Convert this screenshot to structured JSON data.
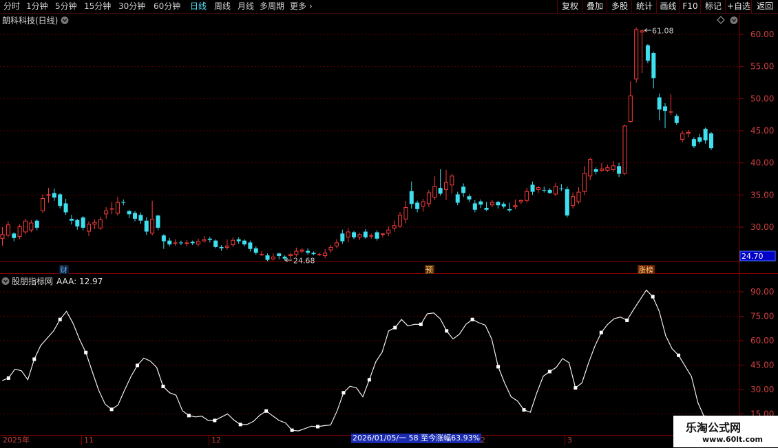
{
  "toolbar": {
    "timeframes": [
      "分时",
      "1分钟",
      "5分钟",
      "15分钟",
      "30分钟",
      "60分钟",
      "日线",
      "周线",
      "月线",
      "多周期",
      "更多"
    ],
    "active": "日线",
    "right_buttons": [
      "复权",
      "叠加",
      "多股",
      "统计",
      "画线",
      "F10",
      "标记",
      "+自选",
      "返回"
    ]
  },
  "main": {
    "title": "朗科科技(日线)",
    "price_axis": [
      "60.00",
      "55.00",
      "50.00",
      "45.00",
      "40.00",
      "35.00",
      "30.00"
    ],
    "last_price": "24.70",
    "high_label": "61.08",
    "low_label": "24.68",
    "markers": [
      "财",
      "预",
      "涨榜"
    ]
  },
  "indicator": {
    "name": "股朋指标网",
    "line_label": "AAA: 12.97",
    "axis": [
      "90.00",
      "75.00",
      "60.00",
      "45.00",
      "30.00",
      "15.00"
    ]
  },
  "xaxis": {
    "labels": [
      "2025年",
      "11",
      "12",
      "2",
      "3"
    ]
  },
  "status_text": "2026/01/05/一 58 至今涨幅63.93%",
  "watermark": {
    "text": "乐淘公式网",
    "url": "www.60lt.com"
  },
  "colors": {
    "up": "#ff3c3c",
    "down": "#3ee0f0",
    "grid": "#6a0000",
    "active_tab": "#4fe6ff"
  },
  "chart_data": {
    "type": "candlestick",
    "candles": [
      [
        28.2,
        28.9,
        27.1,
        30.0
      ],
      [
        28.7,
        30.4,
        28.4,
        30.9
      ],
      [
        29.0,
        28.3,
        27.8,
        29.2
      ],
      [
        28.5,
        30.1,
        28.1,
        30.4
      ],
      [
        29.2,
        31.0,
        28.9,
        31.3
      ],
      [
        29.5,
        30.7,
        29.2,
        31.1
      ],
      [
        31.0,
        29.9,
        29.5,
        31.2
      ],
      [
        32.5,
        34.5,
        32.2,
        35.1
      ],
      [
        34.9,
        35.1,
        33.8,
        36.1
      ],
      [
        35.3,
        34.6,
        34.1,
        36.0
      ],
      [
        35.1,
        33.3,
        32.9,
        35.3
      ],
      [
        33.7,
        32.3,
        31.9,
        34.4
      ],
      [
        31.3,
        31.0,
        30.4,
        31.9
      ],
      [
        31.1,
        30.1,
        29.6,
        31.3
      ],
      [
        31.5,
        29.9,
        29.5,
        31.7
      ],
      [
        29.3,
        30.5,
        28.6,
        30.9
      ],
      [
        30.4,
        30.8,
        29.7,
        31.2
      ],
      [
        29.8,
        31.2,
        29.6,
        31.6
      ],
      [
        32.0,
        32.6,
        31.3,
        33.1
      ],
      [
        32.8,
        32.9,
        32.0,
        33.9
      ],
      [
        32.1,
        33.9,
        31.8,
        34.7
      ],
      [
        33.9,
        33.8,
        33.4,
        34.3
      ],
      [
        32.5,
        32.0,
        31.4,
        32.7
      ],
      [
        32.2,
        31.3,
        30.9,
        32.5
      ],
      [
        31.9,
        31.0,
        30.5,
        32.3
      ],
      [
        31.0,
        29.3,
        28.8,
        31.5
      ],
      [
        29.0,
        31.3,
        28.7,
        34.1
      ],
      [
        31.8,
        29.9,
        29.5,
        31.9
      ],
      [
        28.7,
        27.8,
        26.6,
        28.9
      ],
      [
        27.9,
        27.3,
        27.0,
        28.3
      ],
      [
        27.6,
        27.6,
        27.1,
        28.1
      ],
      [
        27.6,
        27.5,
        27.2,
        27.9
      ],
      [
        27.4,
        27.6,
        27.0,
        28.0
      ],
      [
        27.7,
        27.5,
        27.2,
        27.9
      ],
      [
        27.3,
        27.8,
        27.0,
        28.2
      ],
      [
        27.8,
        28.1,
        27.6,
        28.6
      ],
      [
        28.2,
        28.0,
        27.6,
        28.5
      ],
      [
        27.9,
        26.9,
        26.7,
        28.1
      ],
      [
        26.9,
        26.7,
        26.3,
        27.2
      ],
      [
        26.8,
        27.1,
        26.5,
        28.1
      ],
      [
        27.2,
        28.0,
        26.9,
        28.4
      ],
      [
        28.1,
        27.8,
        27.4,
        28.4
      ],
      [
        27.9,
        27.3,
        27.0,
        28.1
      ],
      [
        27.6,
        26.6,
        26.2,
        27.9
      ],
      [
        26.7,
        26.0,
        25.7,
        27.0
      ],
      [
        25.7,
        25.8,
        25.5,
        26.3
      ],
      [
        25.6,
        24.9,
        24.7,
        25.9
      ],
      [
        25.0,
        25.4,
        24.8,
        25.9
      ],
      [
        25.9,
        25.5,
        25.0,
        26.0
      ],
      [
        25.4,
        25.1,
        24.8,
        25.6
      ],
      [
        25.5,
        25.8,
        25.1,
        26.0
      ],
      [
        25.7,
        26.3,
        25.4,
        26.8
      ],
      [
        26.2,
        26.5,
        25.9,
        26.7
      ],
      [
        26.3,
        26.0,
        25.7,
        26.7
      ],
      [
        26.0,
        25.8,
        25.6,
        26.2
      ],
      [
        25.8,
        25.8,
        25.5,
        26.0
      ],
      [
        25.5,
        26.0,
        25.2,
        26.6
      ],
      [
        26.4,
        26.9,
        26.0,
        27.2
      ],
      [
        27.0,
        27.6,
        26.7,
        28.1
      ],
      [
        29.0,
        27.8,
        27.4,
        29.6
      ],
      [
        28.4,
        29.3,
        27.6,
        29.8
      ],
      [
        29.2,
        28.4,
        28.1,
        29.4
      ],
      [
        28.4,
        28.9,
        28.0,
        29.1
      ],
      [
        29.3,
        28.4,
        28.2,
        29.7
      ],
      [
        28.6,
        28.7,
        28.2,
        29.0
      ],
      [
        29.2,
        28.2,
        27.9,
        29.5
      ],
      [
        28.8,
        29.0,
        28.4,
        29.1
      ],
      [
        29.0,
        29.6,
        28.6,
        30.1
      ],
      [
        29.8,
        30.3,
        29.3,
        31.0
      ],
      [
        30.1,
        31.9,
        29.9,
        32.3
      ],
      [
        31.2,
        33.1,
        30.6,
        34.1
      ],
      [
        35.6,
        33.6,
        32.9,
        37.1
      ],
      [
        33.8,
        32.8,
        32.3,
        34.1
      ],
      [
        33.2,
        34.0,
        32.4,
        34.4
      ],
      [
        33.6,
        35.4,
        33.1,
        35.8
      ],
      [
        34.6,
        36.4,
        34.2,
        37.9
      ],
      [
        36.1,
        35.2,
        34.9,
        39.0
      ],
      [
        35.8,
        37.0,
        34.2,
        38.9
      ],
      [
        36.5,
        38.0,
        35.2,
        38.3
      ],
      [
        35.1,
        33.8,
        33.4,
        35.5
      ],
      [
        36.3,
        35.3,
        34.7,
        36.8
      ],
      [
        34.8,
        34.3,
        33.9,
        35.1
      ],
      [
        33.7,
        32.7,
        32.3,
        34.2
      ],
      [
        34.0,
        33.5,
        33.0,
        34.3
      ],
      [
        33.0,
        32.7,
        32.5,
        33.9
      ],
      [
        33.4,
        33.9,
        33.1,
        34.2
      ],
      [
        33.9,
        33.4,
        32.9,
        34.1
      ],
      [
        33.6,
        33.2,
        32.9,
        33.9
      ],
      [
        32.8,
        32.6,
        32.3,
        33.8
      ],
      [
        33.1,
        33.4,
        32.8,
        34.3
      ],
      [
        33.9,
        34.2,
        33.6,
        34.3
      ],
      [
        34.1,
        35.6,
        33.8,
        36.1
      ],
      [
        36.6,
        35.5,
        35.0,
        37.1
      ],
      [
        35.8,
        36.2,
        35.3,
        36.4
      ],
      [
        35.8,
        35.7,
        35.4,
        36.3
      ],
      [
        35.8,
        35.3,
        35.2,
        36.1
      ],
      [
        35.1,
        36.4,
        34.8,
        36.9
      ],
      [
        36.0,
        35.9,
        35.6,
        36.7
      ],
      [
        35.9,
        31.8,
        31.5,
        36.3
      ],
      [
        33.3,
        34.8,
        32.9,
        35.4
      ],
      [
        33.9,
        35.5,
        33.6,
        36.2
      ],
      [
        35.5,
        38.4,
        35.0,
        39.5
      ],
      [
        37.9,
        40.6,
        37.3,
        40.8
      ],
      [
        39.0,
        38.6,
        38.2,
        39.3
      ],
      [
        38.8,
        39.1,
        38.6,
        40.0
      ],
      [
        38.8,
        39.3,
        38.6,
        39.7
      ],
      [
        38.9,
        39.6,
        38.6,
        40.3
      ],
      [
        39.5,
        38.3,
        37.8,
        40.0
      ],
      [
        38.3,
        45.8,
        38.1,
        45.9
      ],
      [
        46.4,
        50.5,
        46.3,
        52.7
      ],
      [
        53.0,
        60.8,
        52.5,
        61.1
      ],
      [
        60.3,
        60.6,
        54.0,
        60.8
      ],
      [
        58.3,
        55.9,
        55.5,
        58.5
      ],
      [
        57.1,
        53.2,
        51.6,
        57.3
      ],
      [
        50.2,
        48.3,
        46.6,
        50.8
      ],
      [
        48.8,
        48.1,
        45.4,
        49.3
      ],
      [
        47.9,
        48.0,
        47.4,
        50.7
      ],
      [
        47.3,
        46.2,
        45.9,
        47.6
      ],
      [
        43.6,
        44.6,
        43.2,
        45.0
      ],
      [
        44.5,
        44.8,
        44.0,
        45.1
      ],
      [
        43.7,
        42.6,
        42.3,
        44.0
      ],
      [
        44.0,
        43.3,
        43.0,
        44.5
      ],
      [
        45.3,
        43.5,
        43.0,
        45.5
      ],
      [
        44.6,
        42.3,
        42.0,
        44.8
      ]
    ],
    "indicator_values": [
      35.5,
      37.0,
      42.5,
      41.5,
      36.0,
      48.6,
      57.0,
      61.5,
      66.0,
      73.0,
      78.0,
      70.8,
      61.0,
      52.7,
      41.0,
      29.5,
      21.0,
      17.8,
      20.5,
      29.5,
      38.0,
      44.8,
      49.3,
      47.5,
      43.5,
      31.9,
      28.0,
      26.5,
      17.0,
      14.0,
      13.2,
      13.6,
      11.0,
      11.0,
      13.0,
      15.0,
      11.2,
      8.5,
      8.5,
      10.4,
      14.2,
      16.8,
      13.8,
      11.0,
      9.5,
      5.0,
      4.6,
      6.0,
      7.5,
      7.2,
      7.8,
      8.2,
      16.8,
      28.0,
      32.0,
      31.0,
      25.5,
      36.0,
      47.0,
      53.0,
      66.0,
      68.0,
      73.0,
      69.0,
      70.0,
      70.0,
      76.5,
      77.0,
      73.5,
      66.0,
      61.0,
      64.0,
      70.0,
      73.0,
      71.0,
      69.5,
      61.0,
      44.0,
      34.0,
      25.5,
      23.0,
      17.5,
      16.0,
      28.0,
      38.2,
      41.0,
      43.5,
      49.0,
      46.5,
      31.0,
      34.0,
      46.0,
      56.5,
      65.0,
      70.0,
      73.5,
      74.5,
      72.5,
      79.0,
      85.0,
      91.0,
      87.0,
      78.0,
      63.0,
      55.0,
      51.0,
      44.5,
      38.0,
      22.0,
      12.97
    ],
    "price_ylim": [
      24.0,
      62.0
    ],
    "indicator_ylim": [
      0,
      100
    ]
  }
}
